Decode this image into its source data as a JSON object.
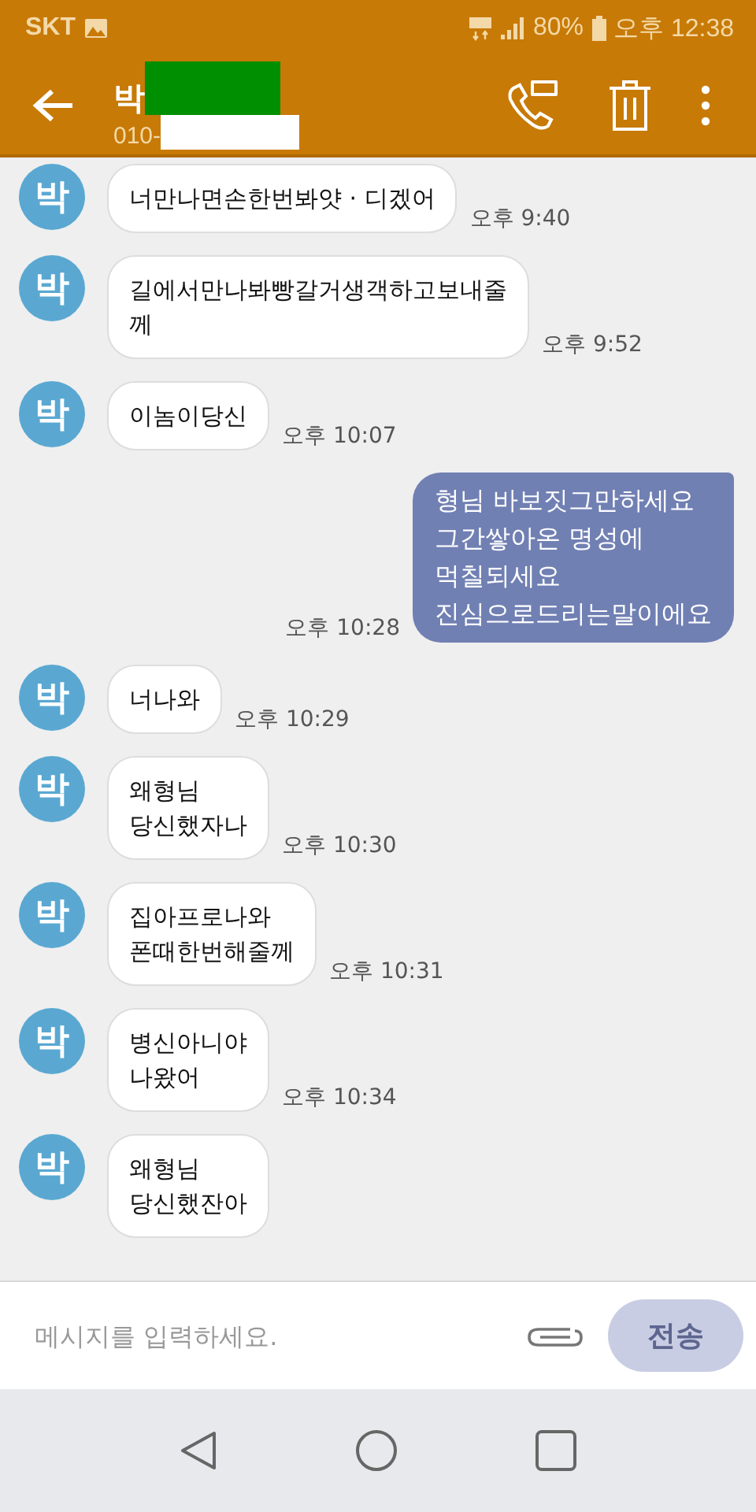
{
  "status_bar": {
    "carrier": "SKT",
    "battery": "80%",
    "time": "오후 12:38"
  },
  "header": {
    "name": "박",
    "number": "010-"
  },
  "messages": [
    {
      "kind": "incoming",
      "avatar": "박",
      "lines": [
        "너만나면손한번봐얏 · 디겠어"
      ],
      "time": "오후 9:40"
    },
    {
      "kind": "incoming",
      "avatar": "박",
      "lines": [
        "길에서만나봐빵갈거생객하고보내줄",
        "께"
      ],
      "time": "오후 9:52"
    },
    {
      "kind": "incoming",
      "avatar": "박",
      "lines": [
        "이놈이당신"
      ],
      "time": "오후 10:07"
    },
    {
      "kind": "outgoing",
      "lines": [
        "형님 바보짓그만하세요",
        "그간쌓아온 명성에",
        "먹칠되세요",
        "진심으로드리는말이에요"
      ],
      "time": "오후 10:28"
    },
    {
      "kind": "incoming",
      "avatar": "박",
      "lines": [
        "너나와"
      ],
      "time": "오후 10:29"
    },
    {
      "kind": "incoming",
      "avatar": "박",
      "lines": [
        "왜형님",
        "당신했자나"
      ],
      "time": "오후 10:30"
    },
    {
      "kind": "incoming",
      "avatar": "박",
      "lines": [
        "집아프로나와",
        "폰때한번해줄께"
      ],
      "time": "오후 10:31"
    },
    {
      "kind": "incoming",
      "avatar": "박",
      "lines": [
        "병신아니야",
        "나왔어"
      ],
      "time": "오후 10:34"
    },
    {
      "kind": "incoming",
      "avatar": "박",
      "lines": [
        "왜형님",
        "당신했잔아"
      ]
    }
  ],
  "composer": {
    "placeholder": "메시지를 입력하세요.",
    "send_label": "전송",
    "send_disabled": true
  }
}
